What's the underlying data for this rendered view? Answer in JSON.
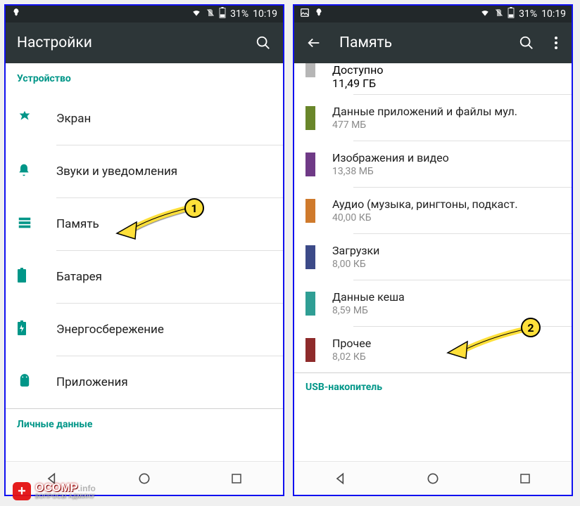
{
  "status": {
    "battery_pct": "31%",
    "time": "10:19"
  },
  "left": {
    "title": "Настройки",
    "section_device": "Устройство",
    "items": [
      {
        "id": "display",
        "label": "Экран"
      },
      {
        "id": "sound",
        "label": "Звуки и уведомления"
      },
      {
        "id": "storage",
        "label": "Память"
      },
      {
        "id": "battery",
        "label": "Батарея"
      },
      {
        "id": "powersave",
        "label": "Энергосбережение"
      },
      {
        "id": "apps",
        "label": "Приложения"
      }
    ],
    "section_personal": "Личные данные"
  },
  "right": {
    "title": "Память",
    "peek_available": {
      "label": "Доступно",
      "value": "11,49 ГБ",
      "color": "#b6b6b6"
    },
    "rows": [
      {
        "label": "Данные приложений и файлы мул.",
        "value": "477 МБ",
        "color": "#69862a"
      },
      {
        "label": "Изображения и видео",
        "value": "13,38 МБ",
        "color": "#6f3a86"
      },
      {
        "label": "Аудио (музыка, рингтоны, подкаст.",
        "value": "40,00 КБ",
        "color": "#cf7a2c"
      },
      {
        "label": "Загрузки",
        "value": "8,00 КБ",
        "color": "#3c4a88"
      },
      {
        "label": "Данные кеша",
        "value": "8,59 МБ",
        "color": "#2f9e94"
      },
      {
        "label": "Прочее",
        "value": "8,02 КБ",
        "color": "#8e2b2b"
      }
    ],
    "usb_section": "USB-накопитель"
  },
  "callouts": {
    "one": "1",
    "two": "2"
  },
  "watermark": {
    "brand": "OCOMP",
    "suffix": ".info",
    "sub": "ВОПРОСЫ АДМИНУ"
  }
}
